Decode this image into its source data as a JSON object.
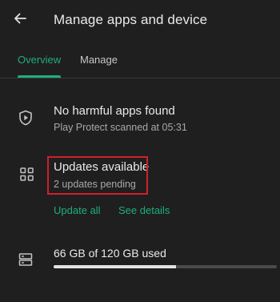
{
  "header": {
    "back_icon": "arrow-left-icon",
    "title": "Manage apps and device"
  },
  "tabs": [
    {
      "label": "Overview",
      "selected": true
    },
    {
      "label": "Manage",
      "selected": false
    }
  ],
  "protect": {
    "icon": "shield-play-icon",
    "title": "No harmful apps found",
    "subtitle": "Play Protect scanned at 05:31"
  },
  "updates": {
    "icon": "apps-grid-icon",
    "title": "Updates available",
    "subtitle": "2 updates pending",
    "update_all_label": "Update all",
    "see_details_label": "See details"
  },
  "storage": {
    "icon": "storage-icon",
    "label": "66 GB of 120 GB used",
    "used_fraction": 0.55
  },
  "colors": {
    "background": "#1f1f1f",
    "accent": "#1fae7a",
    "highlight": "#d21f2a"
  }
}
